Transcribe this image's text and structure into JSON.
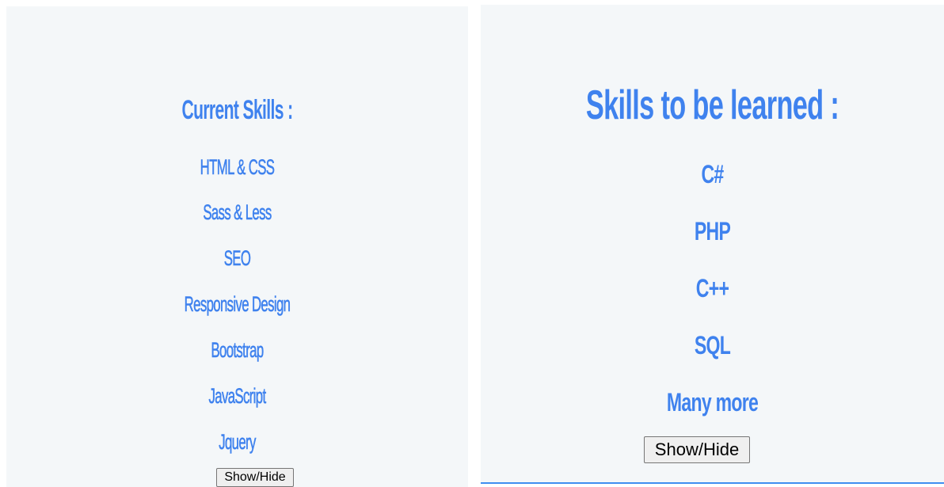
{
  "current_skills": {
    "title": "Current Skills :",
    "items": [
      "HTML & CSS",
      "Sass & Less",
      "SEO",
      "Responsive Design",
      "Bootstrap",
      "JavaScript",
      "Jquery"
    ],
    "toggle_label": "Show/Hide"
  },
  "skills_to_learn": {
    "title": "Skills to be learned :",
    "items": [
      "C#",
      "PHP",
      "C++",
      "SQL",
      "Many more"
    ],
    "toggle_label": "Show/Hide"
  },
  "colors": {
    "accent": "#3f82ee",
    "panel_background": "#f4f7f9"
  }
}
